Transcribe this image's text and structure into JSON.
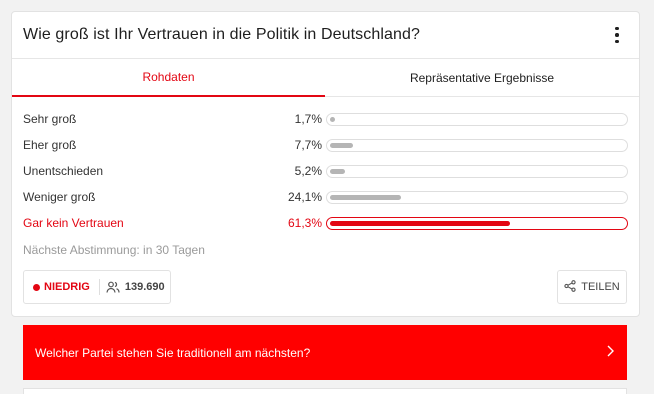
{
  "poll": {
    "question": "Wie groß ist Ihr Vertrauen in die Politik in Deutschland?",
    "tabs": [
      {
        "label": "Rohdaten",
        "active": true
      },
      {
        "label": "Repräsentative Ergebnisse",
        "active": false
      }
    ],
    "options": [
      {
        "label": "Sehr groß",
        "percent_text": "1,7%",
        "percent": 1.7,
        "highlight": false
      },
      {
        "label": "Eher groß",
        "percent_text": "7,7%",
        "percent": 7.7,
        "highlight": false
      },
      {
        "label": "Unentschieden",
        "percent_text": "5,2%",
        "percent": 5.2,
        "highlight": false
      },
      {
        "label": "Weniger groß",
        "percent_text": "24,1%",
        "percent": 24.1,
        "highlight": false
      },
      {
        "label": "Gar kein Vertrauen",
        "percent_text": "61,3%",
        "percent": 61.3,
        "highlight": true
      }
    ],
    "next_vote": "Nächste Abstimmung: in 30 Tagen",
    "level": "NIEDRIG",
    "participants": "139.690",
    "share_label": "TEILEN"
  },
  "next_question": {
    "text": "Welcher Partei stehen Sie traditionell am nächsten?"
  },
  "colors": {
    "accent": "#e30613",
    "cta_background": "#ff0000",
    "bar_default": "#b5b5b5"
  },
  "icons": {
    "menu": "more-vertical-icon",
    "participants": "users-icon",
    "share": "share-icon",
    "cta": "chevron-right-icon"
  }
}
